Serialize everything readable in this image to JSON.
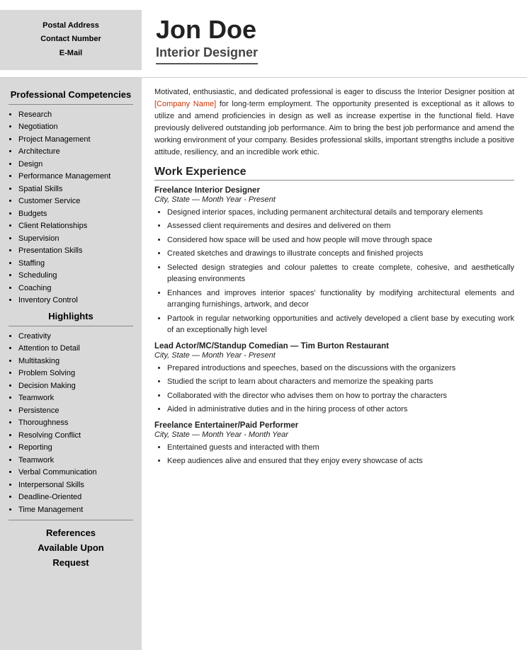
{
  "header": {
    "left_line1": "Postal Address",
    "left_line2": "Contact Number",
    "left_line3": "E-Mail",
    "name": "Jon Doe",
    "title": "Interior Designer"
  },
  "sidebar": {
    "professional_competencies_title": "Professional Competencies",
    "competencies": [
      "Research",
      "Negotiation",
      "Project Management",
      "Architecture",
      "Design",
      "Performance Management",
      "Spatial Skills",
      "Customer Service",
      "Budgets",
      "Client Relationships",
      "Supervision",
      "Presentation Skills",
      "Staffing",
      "Scheduling",
      "Coaching",
      "Inventory Control"
    ],
    "highlights_title": "Highlights",
    "highlights": [
      "Creativity",
      "Attention to Detail",
      "Multitasking",
      "Problem Solving",
      "Decision Making",
      "Teamwork",
      "Persistence",
      "Thoroughness",
      "Resolving Conflict",
      "Reporting",
      "Teamwork",
      "Verbal Communication",
      "Interpersonal Skills",
      "Deadline-Oriented",
      "Time Management"
    ],
    "references_title": "References Available Upon Request"
  },
  "main": {
    "summary": "Motivated, enthusiastic, and dedicated professional is eager to discuss the Interior Designer position at ",
    "company_placeholder": "[Company Name]",
    "summary_cont": " for long-term employment. The opportunity presented is exceptional as it allows to utilize and amend proficiencies in design as well as increase expertise in the functional field. Have previously delivered outstanding job performance. Aim to bring the best job performance and amend the working environment of your company. Besides professional skills, important strengths include a positive attitude, resiliency, and an incredible work ethic.",
    "work_experience_title": "Work Experience",
    "jobs": [
      {
        "title": "Freelance Interior Designer",
        "location": "City, State — Month Year - Present",
        "bullets": [
          "Designed interior spaces, including permanent architectural details and temporary elements",
          "Assessed client requirements and desires and delivered on them",
          "Considered how space will be used and how people will move through space",
          "Created sketches and drawings to illustrate concepts and finished projects",
          "Selected design strategies and colour palettes to create complete, cohesive, and aesthetically pleasing environments",
          "Enhances and improves interior spaces' functionality by modifying architectural elements and arranging furnishings, artwork, and decor",
          "Partook in regular networking opportunities and actively developed a client base by executing work of an exceptionally high level"
        ]
      },
      {
        "title": "Lead Actor/MC/Standup Comedian — Tim Burton Restaurant",
        "location": "City, State — Month Year - Present",
        "bullets": [
          "Prepared introductions and speeches, based on the discussions with the organizers",
          "Studied the script to learn about characters and memorize the speaking parts",
          "Collaborated with the director who advises them on how to portray the characters",
          "Aided in administrative duties and in the hiring process of other actors"
        ]
      },
      {
        "title": "Freelance Entertainer/Paid Performer",
        "location": "City, State — Month Year - Month Year",
        "bullets": [
          "Entertained guests and interacted with them",
          "Keep audiences alive and ensured that they enjoy every showcase of acts"
        ]
      }
    ]
  }
}
